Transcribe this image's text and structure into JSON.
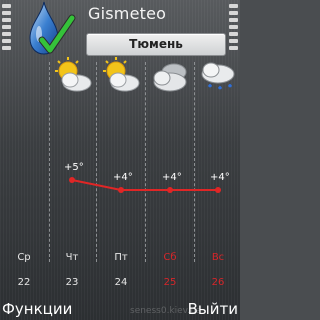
{
  "header": {
    "app_title": "Gismeteo",
    "city": "Тюмень",
    "logo_icon": "gismeteo-drop-check-icon"
  },
  "forecast": {
    "days": [
      {
        "day": "Ср",
        "date": "22",
        "icon": "partly-cloudy-sun-icon",
        "temp": null,
        "weekend": false
      },
      {
        "day": "Чт",
        "date": "23",
        "icon": "partly-cloudy-sun-icon",
        "temp": "+5°",
        "weekend": false
      },
      {
        "day": "Пт",
        "date": "24",
        "icon": "partly-cloudy-sun-icon",
        "temp": "+4°",
        "weekend": false
      },
      {
        "day": "Сб",
        "date": "25",
        "icon": "cloudy-icon",
        "temp": "+4°",
        "weekend": true
      },
      {
        "day": "Вс",
        "date": "26",
        "icon": "cloud-rain-icon",
        "temp": "+4°",
        "weekend": true
      }
    ]
  },
  "chart_data": {
    "type": "line",
    "categories": [
      "Чт",
      "Пт",
      "Сб",
      "Вс"
    ],
    "series": [
      {
        "values": [
          5,
          4,
          4,
          4
        ]
      }
    ],
    "ylim": [
      0,
      10
    ],
    "grid": false,
    "colors": {
      "line": "#e02626",
      "weekend": "#d6262a"
    }
  },
  "softkeys": {
    "left_label": "Функции",
    "right_label": "Выйти"
  },
  "watermark": "seness0.kiev.ua"
}
